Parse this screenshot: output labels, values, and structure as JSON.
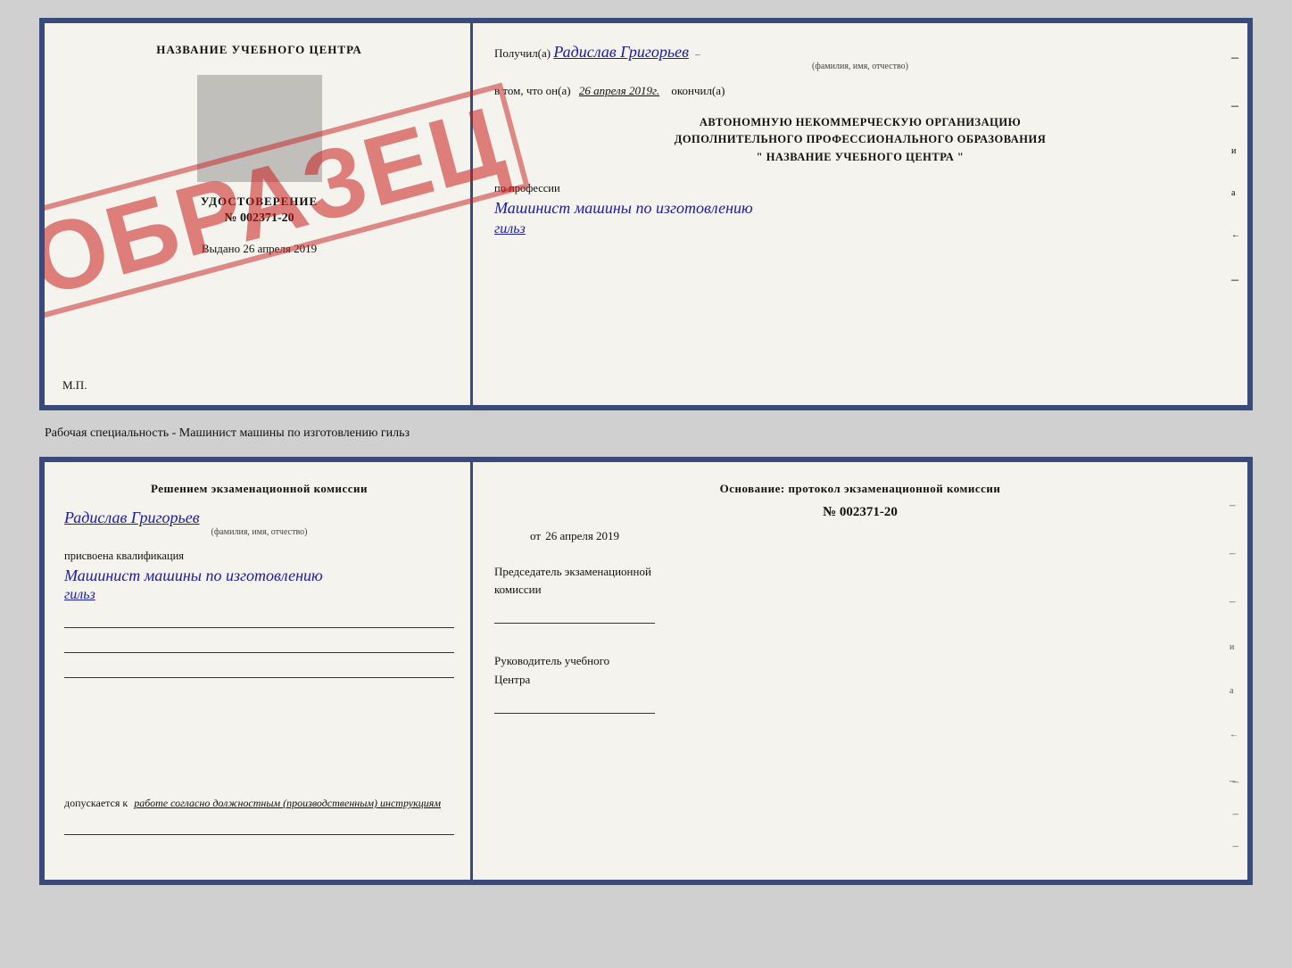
{
  "topCert": {
    "left": {
      "title": "НАЗВАНИЕ УЧЕБНОГО ЦЕНТРА",
      "udostoverenie": "УДОСТОВЕРЕНИЕ",
      "number": "№ 002371-20",
      "vydano": "Выдано",
      "vydano_date": "26 апреля 2019",
      "mp": "М.П.",
      "obrazec": "ОБРАЗЕЦ"
    },
    "right": {
      "poluchil_label": "Получил(а)",
      "recipient_name": "Радислав Григорьев",
      "fio_hint": "(фамилия, имя, отчество)",
      "vtom_prefix": "в том, что он(а)",
      "date": "26 апреля 2019г.",
      "okonchil": "окончил(а)",
      "org_line1": "АВТОНОМНУЮ НЕКОММЕРЧЕСКУЮ ОРГАНИЗАЦИЮ",
      "org_line2": "ДОПОЛНИТЕЛЬНОГО ПРОФЕССИОНАЛЬНОГО ОБРАЗОВАНИЯ",
      "org_line3": "\"  НАЗВАНИЕ УЧЕБНОГО ЦЕНТРА  \"",
      "po_professii": "по профессии",
      "profession_line1": "Машинист машины по изготовлению",
      "profession_line2": "гильз"
    }
  },
  "separator": {
    "text": "Рабочая специальность - Машинист машины по изготовлению гильз"
  },
  "bottomCert": {
    "left": {
      "resheniem": "Решением  экзаменационной  комиссии",
      "name": "Радислав Григорьев",
      "fio_hint": "(фамилия, имя, отчество)",
      "prisvoena": "присвоена квалификация",
      "profession_line1": "Машинист машины по изготовлению",
      "profession_line2": "гильз",
      "dopuskaetsya": "допускается к",
      "work_label": "работе согласно должностным (производственным) инструкциям"
    },
    "right": {
      "osnovanie": "Основание: протокол экзаменационной  комиссии",
      "number": "№  002371-20",
      "ot_label": "от",
      "ot_date": "26 апреля 2019",
      "predsedatel_label": "Председатель экзаменационной",
      "predsedatel_label2": "комиссии",
      "rukovoditel_label": "Руководитель учебного",
      "rukovoditel_label2": "Центра"
    }
  }
}
